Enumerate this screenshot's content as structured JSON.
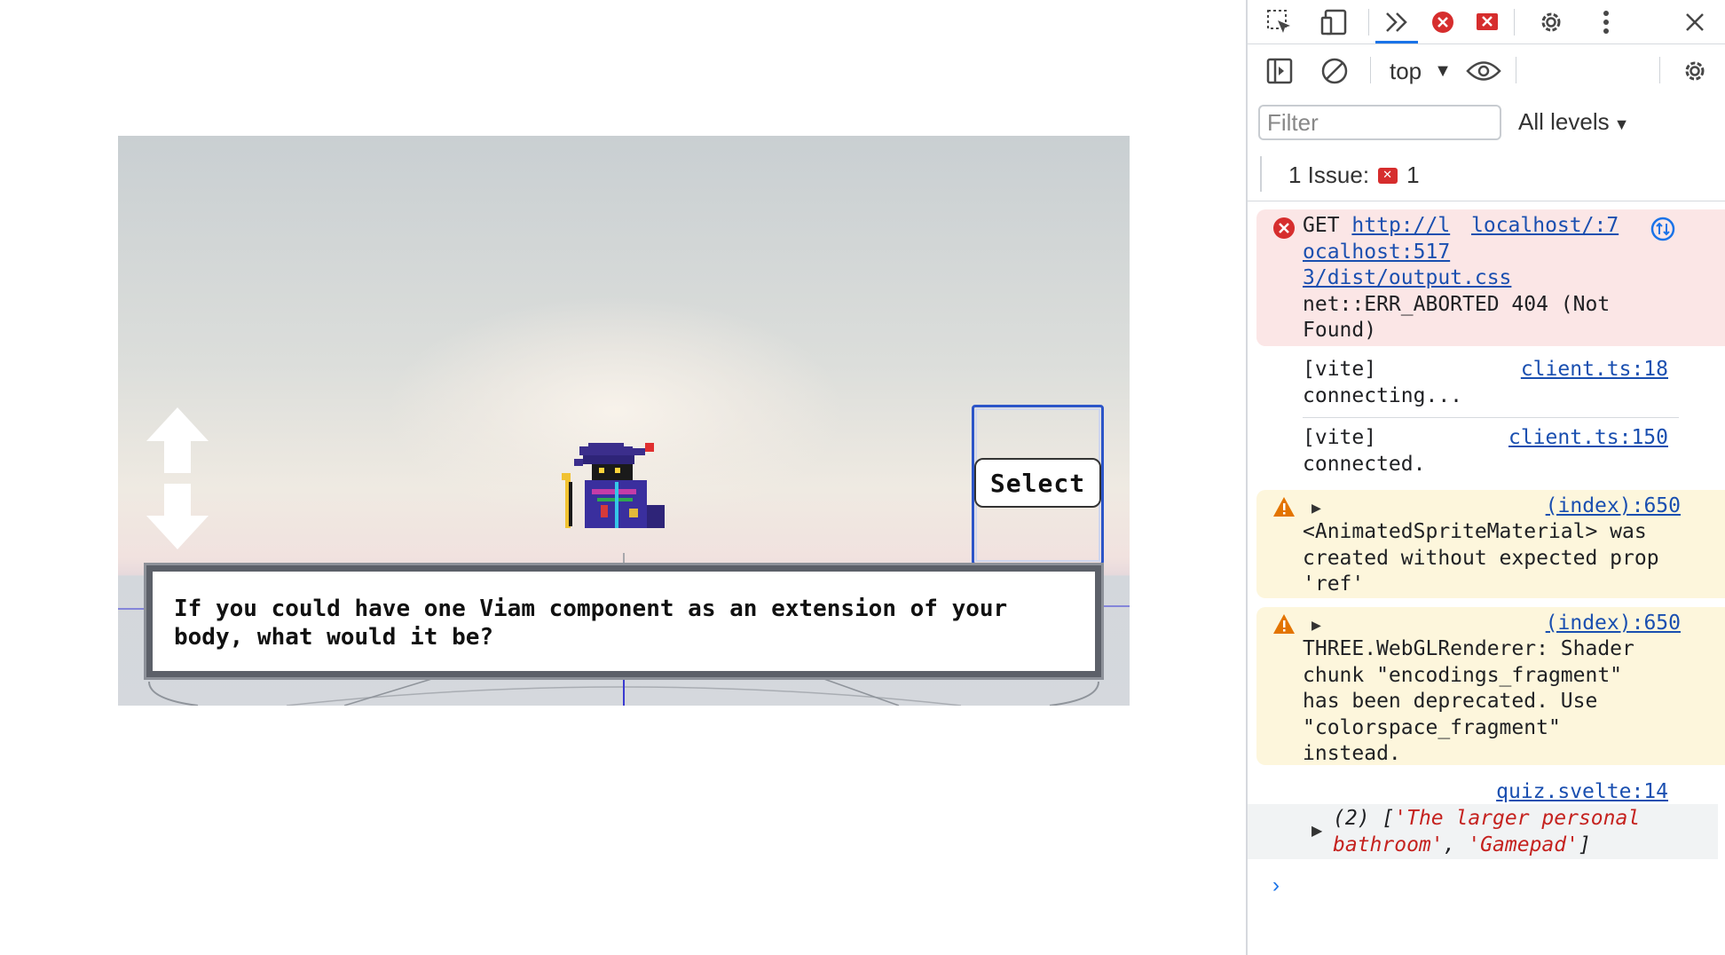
{
  "game": {
    "select_label": "Select",
    "dialog_text": "If you could have one Viam component as an extension of your body, what would it be?"
  },
  "devtools": {
    "toolbar": {
      "inspect_icon": "inspect-element-icon",
      "device_icon": "device-toolbar-icon",
      "more_tabs_icon": "chevrons-right-icon",
      "error_count_icon": "error-circle-icon",
      "issue_icon": "issue-flag-icon",
      "settings_icon": "gear-icon",
      "menu_icon": "kebab-menu-icon",
      "close_icon": "close-icon"
    },
    "console_toolbar": {
      "context": "top",
      "filter_placeholder": "Filter",
      "levels": "All levels"
    },
    "issues": {
      "label": "1 Issue:",
      "count": "1"
    },
    "messages": {
      "error": {
        "method": "GET",
        "url_line1": "http://l",
        "url_line2": "ocalhost:517",
        "url_line3": "3/dist/output.css",
        "source": "localhost/:7",
        "text_line1": "net::ERR_ABORTED 404 (Not",
        "text_line2": "Found)"
      },
      "vite_connecting": {
        "line1": "[vite]",
        "line2": "connecting...",
        "source": "client.ts:18"
      },
      "vite_connected": {
        "line1": "[vite]",
        "line2": "connected.",
        "source": "client.ts:150"
      },
      "warn1": {
        "source": "(index):650",
        "line1": "<AnimatedSpriteMaterial> was",
        "line2": "created without expected prop",
        "line3": "'ref'"
      },
      "warn2": {
        "source": "(index):650",
        "line1": "THREE.WebGLRenderer: Shader",
        "line2": "chunk \"encodings_fragment\"",
        "line3": "has been deprecated. Use",
        "line4": "\"colorspace_fragment\"",
        "line5": "instead."
      },
      "log": {
        "source": "quiz.svelte:14",
        "prefix": "(2) [",
        "item1": "'The larger personal",
        "item1b": "bathroom'",
        "sep": ", ",
        "item2": "'Gamepad'",
        "suffix": "]"
      }
    },
    "prompt": "›"
  }
}
